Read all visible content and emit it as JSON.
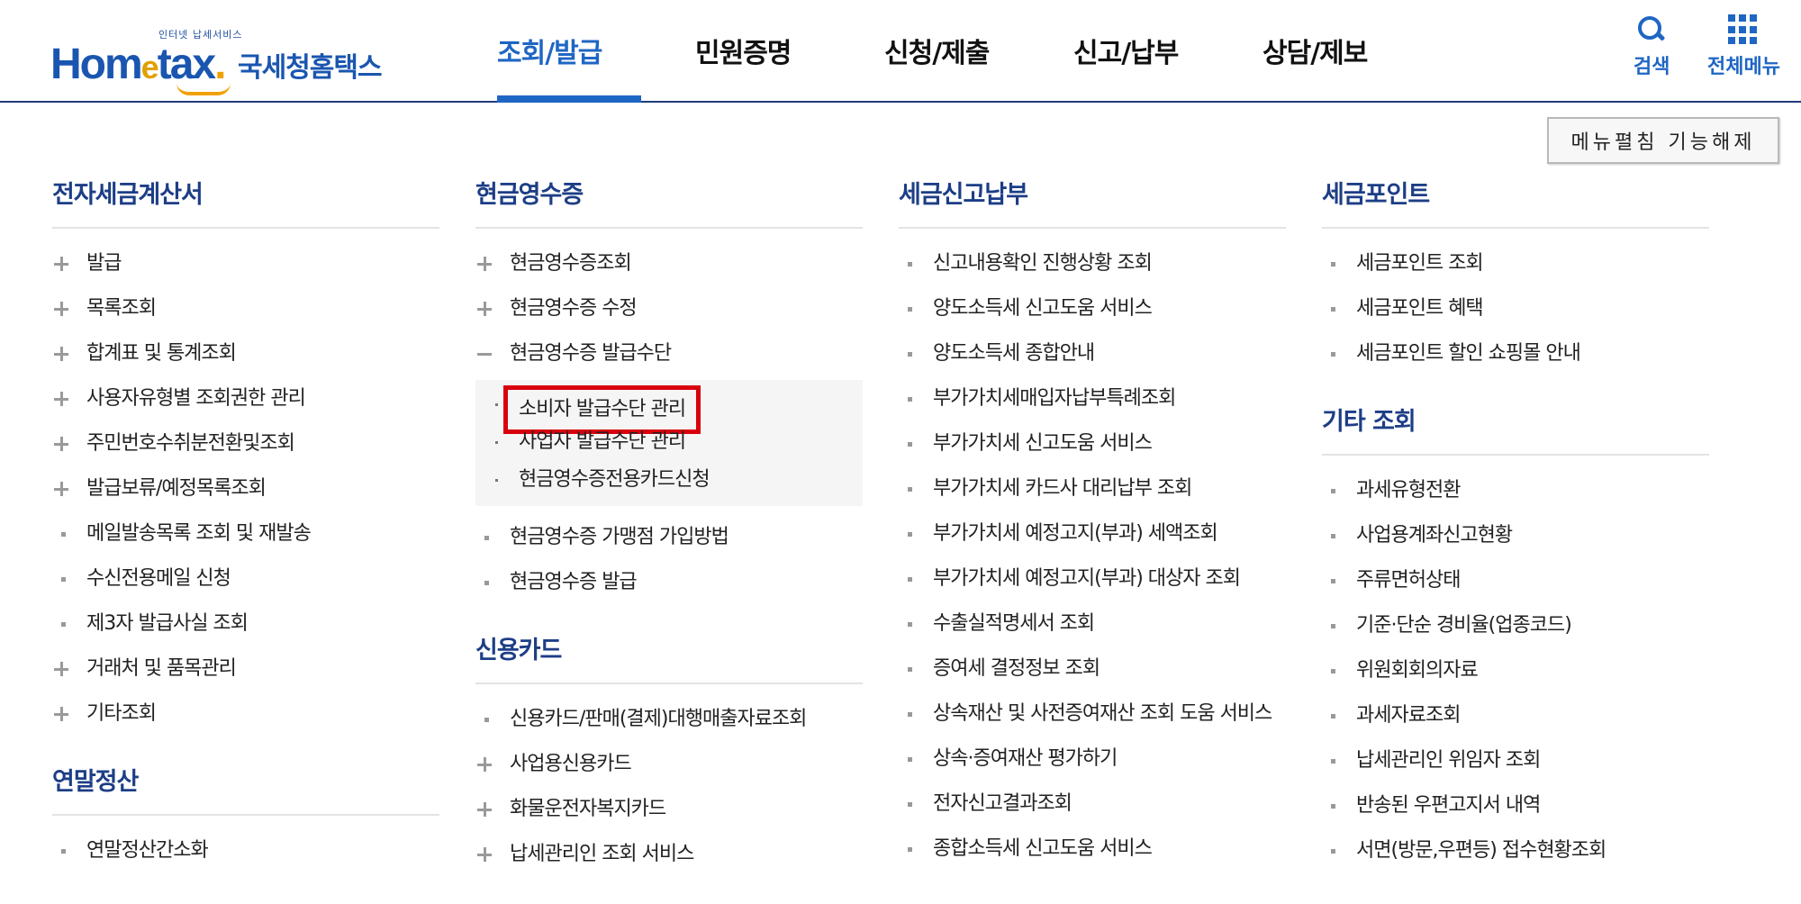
{
  "header": {
    "logo": {
      "tagline": "인터넷 납세서비스",
      "brand_a": "Hom",
      "brand_e": "e",
      "brand_b": "tax",
      "brand_dot": ".",
      "kr": "국세청홈택스"
    },
    "nav": [
      "조회/발급",
      "민원증명",
      "신청/제출",
      "신고/납부",
      "상담/제보"
    ],
    "active_nav": 0,
    "search_label": "검색",
    "allmenu_label": "전체메뉴"
  },
  "fold_button_label": "메뉴펼침 기능해제",
  "columns": [
    {
      "sections": [
        {
          "title": "전자세금계산서",
          "items": [
            {
              "label": "발급",
              "marker": "plus"
            },
            {
              "label": "목록조회",
              "marker": "plus"
            },
            {
              "label": "합계표 및 통계조회",
              "marker": "plus"
            },
            {
              "label": "사용자유형별 조회권한 관리",
              "marker": "plus"
            },
            {
              "label": "주민번호수취분전환및조회",
              "marker": "plus"
            },
            {
              "label": "발급보류/예정목록조회",
              "marker": "plus"
            },
            {
              "label": "메일발송목록 조회 및 재발송",
              "marker": "sq"
            },
            {
              "label": "수신전용메일 신청",
              "marker": "sq"
            },
            {
              "label": "제3자 발급사실 조회",
              "marker": "sq"
            },
            {
              "label": "거래처 및 품목관리",
              "marker": "plus"
            },
            {
              "label": "기타조회",
              "marker": "plus"
            }
          ]
        },
        {
          "title": "연말정산",
          "items": [
            {
              "label": "연말정산간소화",
              "marker": "sq"
            }
          ]
        }
      ]
    },
    {
      "sections": [
        {
          "title": "현금영수증",
          "items": [
            {
              "label": "현금영수증조회",
              "marker": "plus"
            },
            {
              "label": "현금영수증 수정",
              "marker": "plus"
            },
            {
              "label": "현금영수증 발급수단",
              "marker": "minus",
              "sub": [
                "소비자 발급수단 관리",
                "사업자 발급수단 관리",
                "현금영수증전용카드신청"
              ],
              "highlight": 0
            },
            {
              "label": "현금영수증 가맹점 가입방법",
              "marker": "sq"
            },
            {
              "label": "현금영수증 발급",
              "marker": "sq"
            }
          ]
        },
        {
          "title": "신용카드",
          "items": [
            {
              "label": "신용카드/판매(결제)대행매출자료조회",
              "marker": "sq"
            },
            {
              "label": "사업용신용카드",
              "marker": "plus"
            },
            {
              "label": "화물운전자복지카드",
              "marker": "plus"
            },
            {
              "label": "납세관리인 조회 서비스",
              "marker": "plus"
            }
          ]
        }
      ]
    },
    {
      "sections": [
        {
          "title": "세금신고납부",
          "items": [
            {
              "label": "신고내용확인 진행상황 조회",
              "marker": "sq"
            },
            {
              "label": "양도소득세 신고도움 서비스",
              "marker": "sq"
            },
            {
              "label": "양도소득세 종합안내",
              "marker": "sq"
            },
            {
              "label": "부가가치세매입자납부특례조회",
              "marker": "sq"
            },
            {
              "label": "부가가치세 신고도움 서비스",
              "marker": "sq"
            },
            {
              "label": "부가가치세 카드사 대리납부 조회",
              "marker": "sq"
            },
            {
              "label": "부가가치세 예정고지(부과) 세액조회",
              "marker": "sq"
            },
            {
              "label": "부가가치세 예정고지(부과) 대상자 조회",
              "marker": "sq"
            },
            {
              "label": "수출실적명세서 조회",
              "marker": "sq"
            },
            {
              "label": "증여세 결정정보 조회",
              "marker": "sq"
            },
            {
              "label": "상속재산 및 사전증여재산 조회 도움 서비스",
              "marker": "sq"
            },
            {
              "label": "상속·증여재산 평가하기",
              "marker": "sq"
            },
            {
              "label": "전자신고결과조회",
              "marker": "sq"
            },
            {
              "label": "종합소득세 신고도움 서비스",
              "marker": "sq"
            }
          ]
        }
      ]
    },
    {
      "sections": [
        {
          "title": "세금포인트",
          "items": [
            {
              "label": "세금포인트 조회",
              "marker": "sq"
            },
            {
              "label": "세금포인트 혜택",
              "marker": "sq"
            },
            {
              "label": "세금포인트 할인 쇼핑몰 안내",
              "marker": "sq"
            }
          ]
        },
        {
          "title": "기타 조회",
          "items": [
            {
              "label": "과세유형전환",
              "marker": "sq"
            },
            {
              "label": "사업용계좌신고현황",
              "marker": "sq"
            },
            {
              "label": "주류면허상태",
              "marker": "sq"
            },
            {
              "label": "기준·단순 경비율(업종코드)",
              "marker": "sq"
            },
            {
              "label": "위원회회의자료",
              "marker": "sq"
            },
            {
              "label": "과세자료조회",
              "marker": "sq"
            },
            {
              "label": "납세관리인 위임자 조회",
              "marker": "sq"
            },
            {
              "label": "반송된 우편고지서 내역",
              "marker": "sq"
            },
            {
              "label": "서면(방문,우편등) 접수현황조회",
              "marker": "sq"
            }
          ]
        }
      ]
    }
  ]
}
